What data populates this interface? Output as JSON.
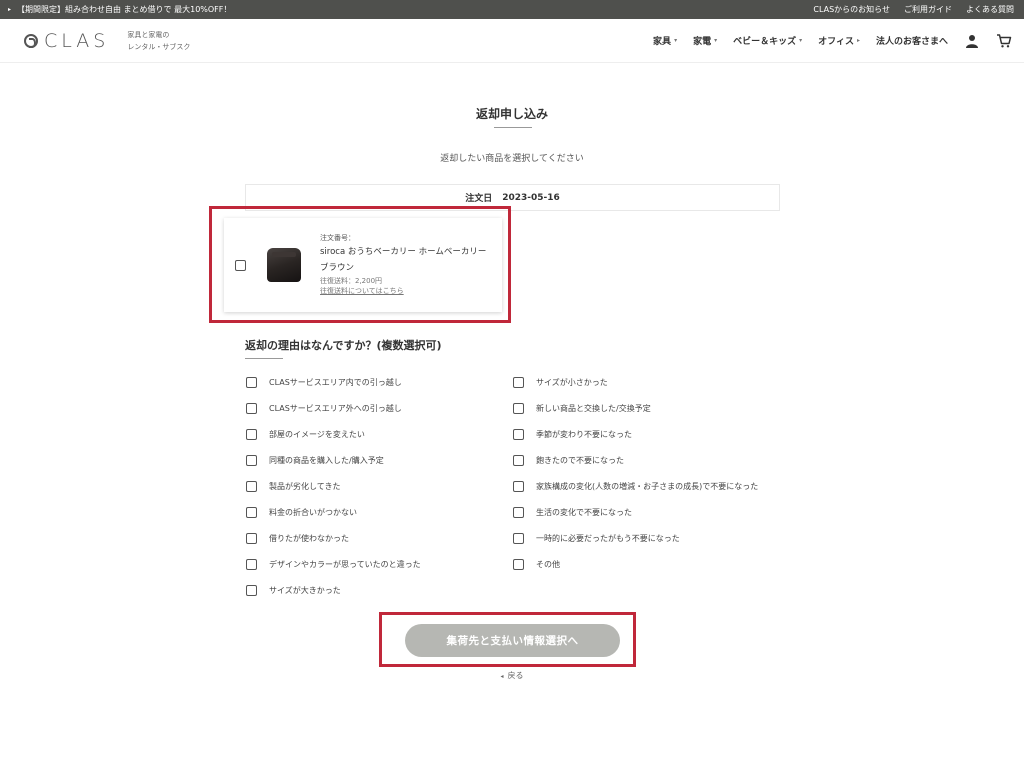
{
  "promo": {
    "arrow": "▸",
    "text": "【期間限定】組み合わせ自由 まとめ借りで 最大10%OFF！",
    "links": [
      "CLASからのお知らせ",
      "ご利用ガイド",
      "よくある質問"
    ]
  },
  "header": {
    "logo": "CLAS",
    "tagline_1": "家具と家電の",
    "tagline_2": "レンタル・サブスク",
    "nav": [
      {
        "label": "家具",
        "caret": "▾"
      },
      {
        "label": "家電",
        "caret": "▾"
      },
      {
        "label": "ベビー＆キッズ",
        "caret": "▾"
      },
      {
        "label": "オフィス",
        "caret": "▸"
      },
      {
        "label": "法人のお客さまへ",
        "caret": ""
      }
    ]
  },
  "page": {
    "title": "返却申し込み",
    "subtitle": "返却したい商品を選択してください",
    "order_date_label": "注文日",
    "order_date": "2023-05-16"
  },
  "product": {
    "order_no_label": "注文番号：",
    "name_line1": "siroca おうちベーカリー ホームベーカリー",
    "name_line2": "ブラウン",
    "fee": "往復送料：2,200円",
    "fee_link": "往復送料についてはこちら"
  },
  "reasons": {
    "title": "返却の理由はなんですか？(複数選択可)",
    "left": [
      "CLASサービスエリア内での引っ越し",
      "CLASサービスエリア外への引っ越し",
      "部屋のイメージを変えたい",
      "同種の商品を購入した/購入予定",
      "製品が劣化してきた",
      "料金の折合いがつかない",
      "借りたが使わなかった",
      "デザインやカラーが思っていたのと違った",
      "サイズが大きかった"
    ],
    "right": [
      "サイズが小さかった",
      "新しい商品と交換した/交換予定",
      "季節が変わり不要になった",
      "飽きたので不要になった",
      "家族構成の変化(人数の増減・お子さまの成長)で不要になった",
      "生活の変化で不要になった",
      "一時的に必要だったがもう不要になった",
      "その他"
    ]
  },
  "actions": {
    "submit": "集荷先と支払い情報選択へ",
    "back_arrow": "◂",
    "back": "戻る"
  },
  "colors": {
    "promo_bg": "#4f504d",
    "highlight": "#c0283a",
    "button_bg": "#b6b7b3"
  }
}
